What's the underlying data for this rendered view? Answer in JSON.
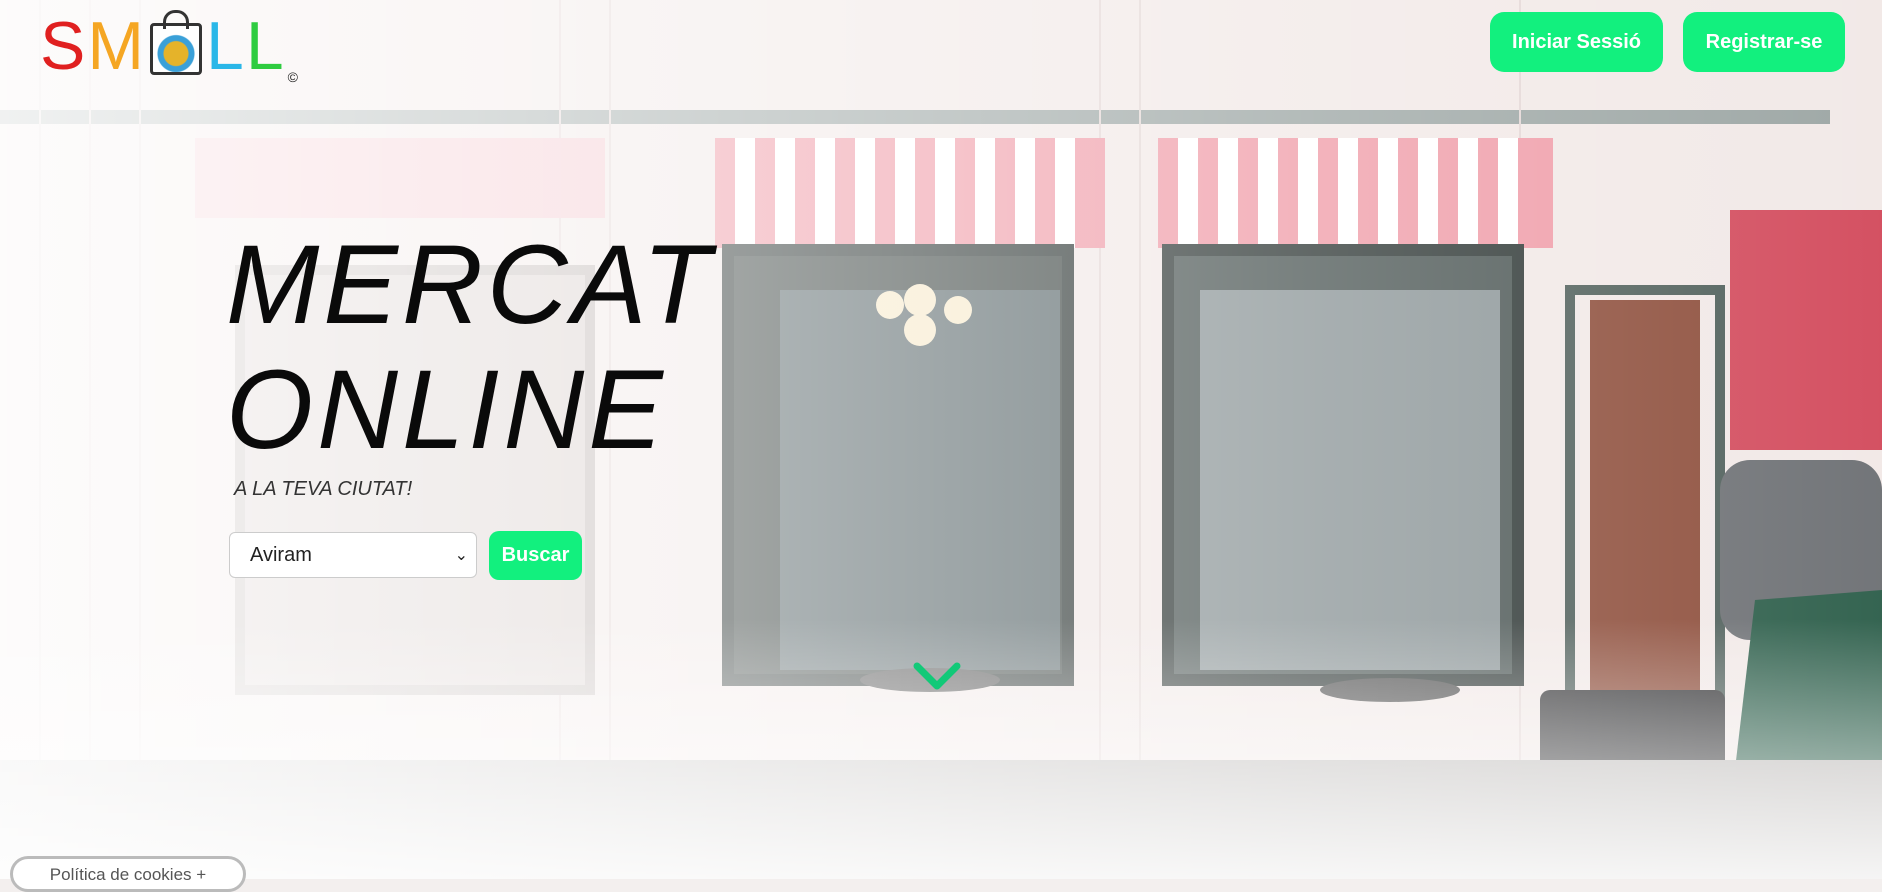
{
  "brand": {
    "letters": [
      "S",
      "M",
      "L",
      "L"
    ],
    "letter_colors": [
      "#e02020",
      "#f5a623",
      "#2ab7e8",
      "#2ecc40"
    ],
    "copyright": "©",
    "bag_icon": "shopping-bag-icon"
  },
  "header": {
    "login_label": "Iniciar Sessió",
    "register_label": "Registrar-se"
  },
  "hero": {
    "title_line1": "MERCAT",
    "title_line2": "ONLINE",
    "subtitle": "A LA TEVA CIUTAT!",
    "city_select_value": "Aviram",
    "search_label": "Buscar",
    "scroll_icon": "chevron-down-icon"
  },
  "footer": {
    "cookies_label": "Política de cookies +"
  },
  "colors": {
    "accent": "#12f07e"
  }
}
